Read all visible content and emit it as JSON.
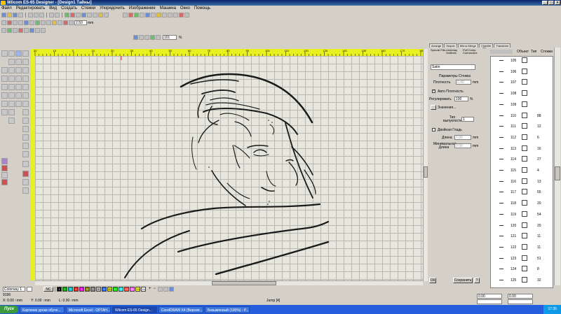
{
  "window": {
    "title": "Wilcom ES-65 Designer - [Design1      Тайны]",
    "buttons": [
      "_",
      "□",
      "×"
    ]
  },
  "menu": [
    "Файл",
    "Редактировать",
    "Вид",
    "Создать",
    "Стежки",
    "Упорядочить",
    "Изображение",
    "Машина",
    "Окно",
    "Помощь"
  ],
  "toolbar": {
    "stitch_length_value": "2.50",
    "stitch_length_unit": "mm",
    "zoom_value": "101",
    "zoom_unit": "%"
  },
  "ruler": {
    "x_ticks": [
      "20",
      "10",
      "0",
      "10",
      "20",
      "30",
      "40",
      "50",
      "60",
      "70",
      "80",
      "90",
      "100",
      "110",
      "120",
      "130",
      "140",
      "150",
      "160",
      "170",
      "180"
    ]
  },
  "right_tabs": [
    "Arrange",
    "Sequin",
    "Mirror-Merge",
    "Chenille",
    "Transform"
  ],
  "properties": {
    "subtabs": [
      "Special Fills",
      "Underlay Outlines",
      "Pull Comp Connectors"
    ],
    "fill_type": "Satin",
    "section_title": "Параметры Стежка",
    "density_label": "Плотность",
    "density_value": "0.40",
    "density_unit": "mm",
    "auto_density_label": "Авто Плотность",
    "adjust_label": "Регулировать",
    "adjust_value": "100",
    "adjust_unit": "%",
    "values_button": "Значения...",
    "count_label": "Тип выпуклости",
    "count_value": "1",
    "split_label": "Двойная Гладь",
    "length_label": "Длина",
    "length_value": "7.00",
    "length_unit": "mm",
    "min_length_label": "Минимальная Длина",
    "min_length_value": "0.00",
    "min_length_unit": "mm",
    "apply_button": "Сохранить",
    "ok_button": "ОК",
    "help_button": "?"
  },
  "object_panel": {
    "headers": [
      "Объект",
      "Тип",
      "Стежки"
    ],
    "rows": [
      {
        "num": "105",
        "stitches": ""
      },
      {
        "num": "106",
        "stitches": ""
      },
      {
        "num": "107",
        "stitches": ""
      },
      {
        "num": "108",
        "stitches": ""
      },
      {
        "num": "109",
        "stitches": ""
      },
      {
        "num": "110",
        "stitches": "88"
      },
      {
        "num": "111",
        "stitches": "12"
      },
      {
        "num": "112",
        "stitches": "6"
      },
      {
        "num": "113",
        "stitches": "16"
      },
      {
        "num": "114",
        "stitches": "27"
      },
      {
        "num": "115",
        "stitches": "4"
      },
      {
        "num": "116",
        "stitches": "13"
      },
      {
        "num": "117",
        "stitches": "55"
      },
      {
        "num": "118",
        "stitches": "20"
      },
      {
        "num": "119",
        "stitches": "54"
      },
      {
        "num": "120",
        "stitches": "20"
      },
      {
        "num": "121",
        "stitches": "11"
      },
      {
        "num": "122",
        "stitches": "11"
      },
      {
        "num": "123",
        "stitches": "51"
      },
      {
        "num": "124",
        "stitches": "8"
      },
      {
        "num": "125",
        "stitches": "32"
      }
    ]
  },
  "colorbar": {
    "colorway": "Colorway 1",
    "nc": "NC",
    "swatches": [
      {
        "label": "1",
        "color": "#000000"
      },
      {
        "label": "2",
        "color": "#00a000"
      },
      {
        "label": "3",
        "color": "#00c0c0"
      },
      {
        "label": "4",
        "color": "#e02020"
      },
      {
        "label": "5",
        "color": "#e000e0"
      },
      {
        "label": "6",
        "color": "#808000"
      },
      {
        "label": "7",
        "color": "#808080"
      },
      {
        "label": "8",
        "color": "#c0c0c0"
      },
      {
        "label": "9",
        "color": "#2060e0"
      },
      {
        "label": "10",
        "color": "#e0e020"
      },
      {
        "label": "11",
        "color": "#00e000"
      },
      {
        "label": "12",
        "color": "#20e0e0"
      },
      {
        "label": "13",
        "color": "#ff4040"
      },
      {
        "label": "14",
        "color": "#ff60ff"
      },
      {
        "label": "15",
        "color": "#ffff40"
      },
      {
        "label": "16",
        "color": "#ffffff"
      }
    ]
  },
  "status": {
    "left": "9196",
    "coords_x": "X: 0.00 ↑mm",
    "coords_y": "Y: 0.00 ↑mm",
    "coords_l": "L: 0.00 ↑mm",
    "center": "Jump [4]",
    "right1": "0.00",
    "right2": "0.00"
  },
  "taskbar": {
    "start": "Пуск",
    "tasks": [
      "Картинки уроки обуче...",
      "Microsoft Excel - ОРГАН...",
      "Wilcom ES-65 Design...",
      "CorelDRAW X4 (Версия ...",
      "Безымянный (100%) - Р..."
    ],
    "active_index": 2,
    "clock": "17:35"
  }
}
